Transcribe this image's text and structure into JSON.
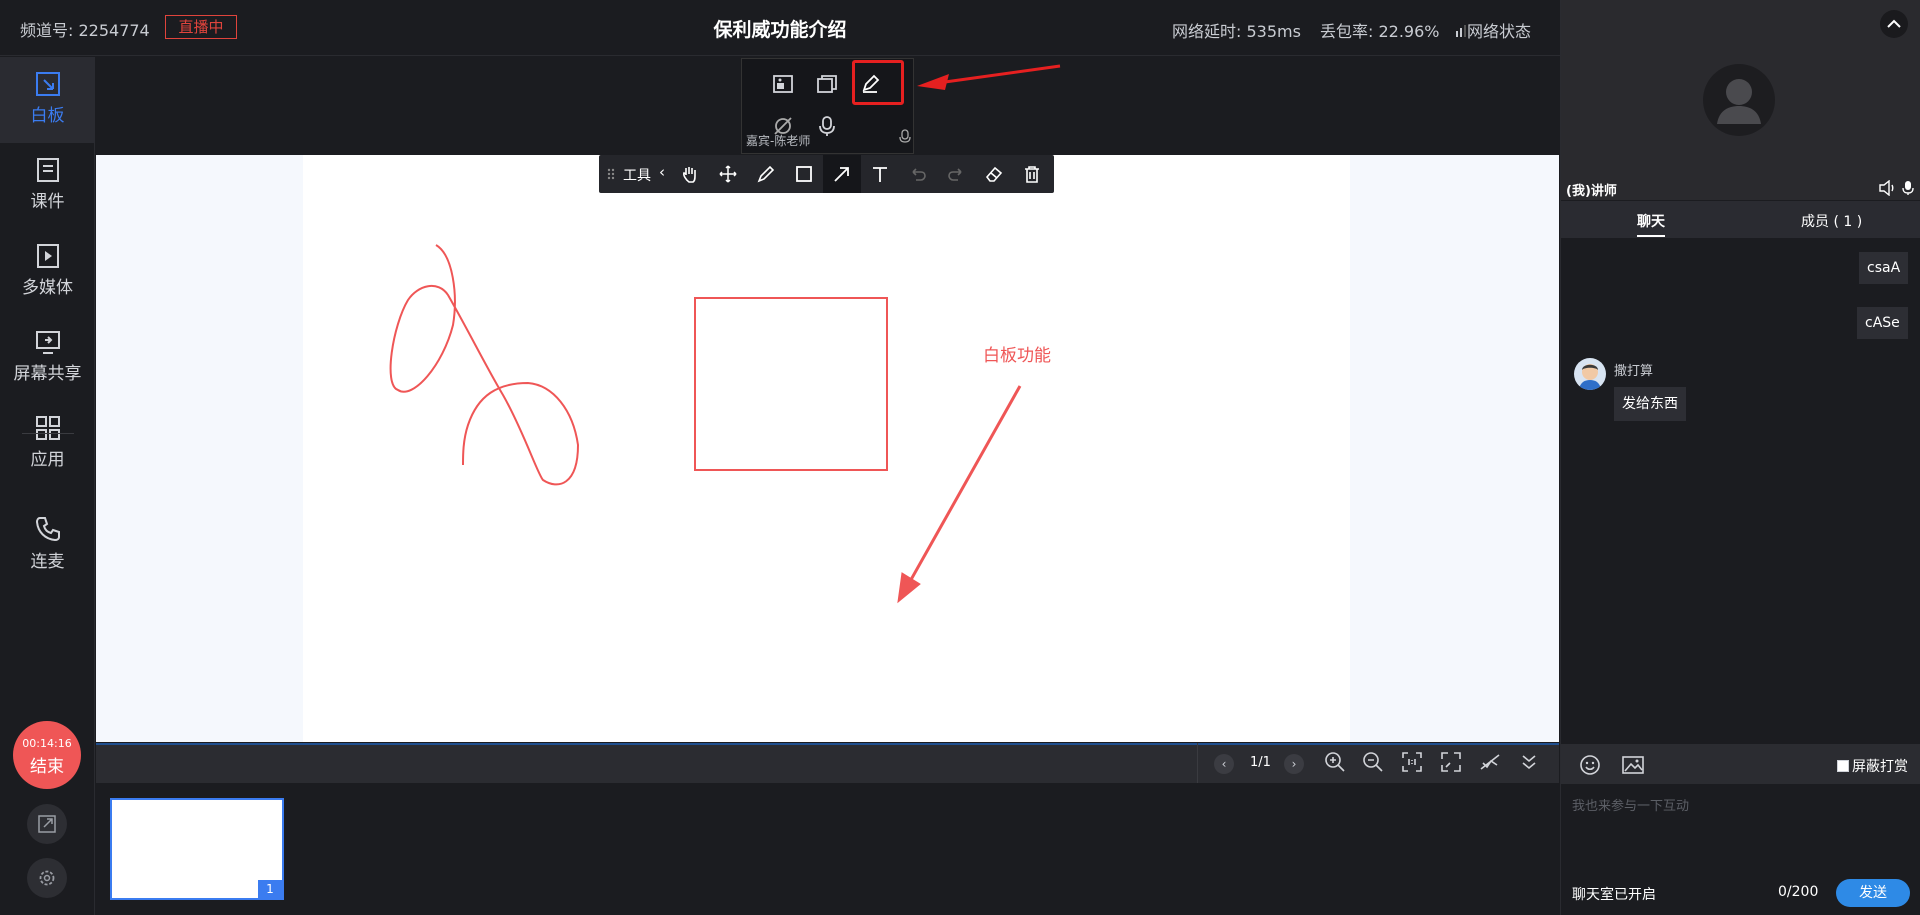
{
  "topbar": {
    "channel": "频道号: 2254774",
    "live_badge": "直播中",
    "title": "保利威功能介绍",
    "latency": "网络延时: 535ms",
    "packet_loss": "丢包率: 22.96%",
    "network_status": "网络状态"
  },
  "sidebar": {
    "items": [
      {
        "label": "白板",
        "icon": "whiteboard-icon"
      },
      {
        "label": "课件",
        "icon": "document-icon"
      },
      {
        "label": "多媒体",
        "icon": "play-icon"
      },
      {
        "label": "屏幕共享",
        "icon": "screen-share-icon"
      },
      {
        "label": "应用",
        "icon": "grid-icon"
      },
      {
        "label": "连麦",
        "icon": "phone-icon"
      }
    ],
    "end_timer": "00:14:16",
    "end_label": "结束"
  },
  "mini_panel": {
    "label": "嘉宾-陈老师"
  },
  "toolbar": {
    "label": "工具",
    "tools": [
      "hand-icon",
      "move-icon",
      "pen-icon",
      "rectangle-icon",
      "arrow-icon",
      "text-icon",
      "undo-icon",
      "redo-icon",
      "eraser-icon",
      "delete-icon"
    ],
    "active_tool": "arrow-icon"
  },
  "whiteboard": {
    "annotation_text": "白板功能",
    "stroke_color": "#ef5656"
  },
  "page_nav": {
    "indicator": "1/1",
    "prev": "‹",
    "next": "›"
  },
  "thumbnails": [
    {
      "number": "1"
    }
  ],
  "right_panel": {
    "video_label": "(我)讲师",
    "tabs": {
      "chat": "聊天",
      "members": "成员 ( 1 )"
    },
    "messages_self": [
      "csaA",
      "cASe"
    ],
    "message_other": {
      "name": "撒打算",
      "text": "发给东西"
    },
    "mute_reward": "屏蔽打赏",
    "input_placeholder": "我也来参与一下互动",
    "chat_status": "聊天室已开启",
    "char_count": "0/200",
    "send": "发送"
  },
  "colors": {
    "accent": "#3b7cf0",
    "danger": "#ef5656",
    "send": "#2e8ae6"
  }
}
